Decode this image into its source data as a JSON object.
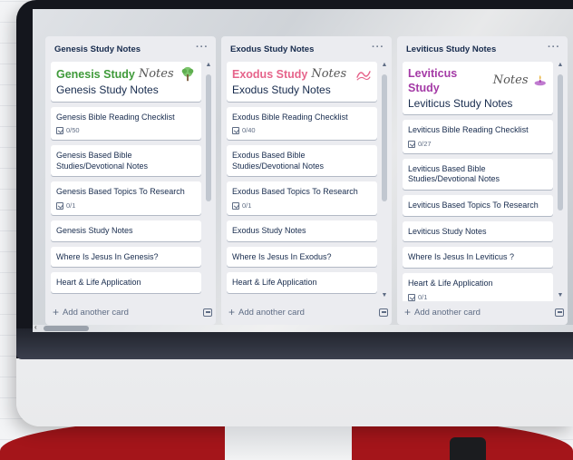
{
  "colors": {
    "genesis": "#3f9a3a",
    "exodus": "#e6648b",
    "leviticus": "#a43aa6",
    "list_bg": "#ebecf0",
    "text": "#172b4d",
    "muted": "#5e6c84",
    "frame_red": "#a4151a",
    "teal": "#1aa39b"
  },
  "lists": [
    {
      "title": "Genesis Study Notes",
      "menu": "···",
      "cover": {
        "big": "Genesis Study",
        "script": "Notes",
        "sub": "Genesis Study Notes",
        "icon": "tree-icon"
      },
      "cards": [
        {
          "title": "Genesis Bible Reading Checklist",
          "badge": "0/50"
        },
        {
          "title": "Genesis Based Bible Studies/Devotional Notes"
        },
        {
          "title": "Genesis Based Topics To Research",
          "badge": "0/1"
        },
        {
          "title": "Genesis Study Notes"
        },
        {
          "title": "Where Is Jesus In Genesis?"
        },
        {
          "title": "Heart & Life Application"
        }
      ],
      "add": "Add another card"
    },
    {
      "title": "Exodus Study Notes",
      "menu": "···",
      "cover": {
        "big": "Exodus Study",
        "script": "Notes",
        "sub": "Exodus Study Notes",
        "icon": "waves-icon"
      },
      "cards": [
        {
          "title": "Exodus Bible Reading Checklist",
          "badge": "0/40"
        },
        {
          "title": "Exodus Based Bible Studies/Devotional Notes"
        },
        {
          "title": "Exodus Based Topics To Research",
          "badge": "0/1"
        },
        {
          "title": "Exodus Study Notes"
        },
        {
          "title": "Where Is Jesus In Exodus?"
        },
        {
          "title": "Heart & Life Application"
        }
      ],
      "add": "Add another card"
    },
    {
      "title": "Leviticus Study Notes",
      "menu": "···",
      "cover": {
        "big": "Leviticus Study",
        "script": "Notes",
        "sub": "Leviticus Study Notes",
        "icon": "lamp-icon"
      },
      "cards": [
        {
          "title": "Leviticus Bible Reading Checklist",
          "badge": "0/27"
        },
        {
          "title": "Leviticus Based Bible Studies/Devotional Notes"
        },
        {
          "title": "Leviticus Based Topics To Research"
        },
        {
          "title": "Leviticus Study Notes"
        },
        {
          "title": "Where Is Jesus In Leviticus ?"
        },
        {
          "title": "Heart & Life Application",
          "badge": "0/1"
        }
      ],
      "add": "Add another card"
    }
  ],
  "scroll": {
    "left_arrow": "‹"
  }
}
